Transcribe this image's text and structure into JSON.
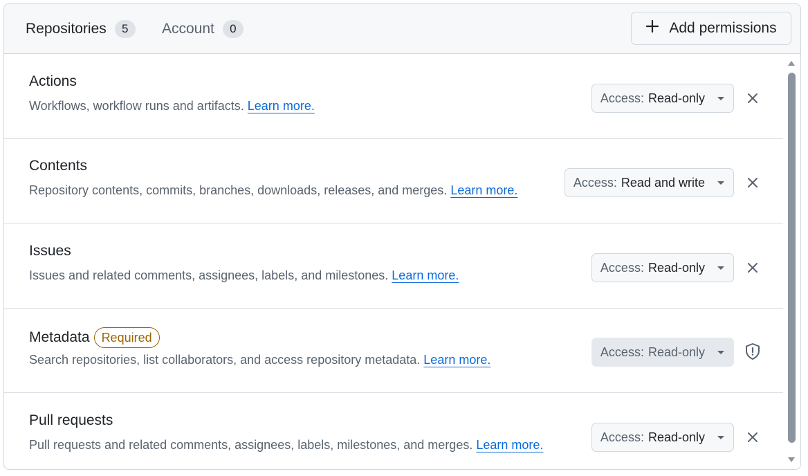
{
  "tabs": [
    {
      "label": "Repositories",
      "count": "5"
    },
    {
      "label": "Account",
      "count": "0"
    }
  ],
  "add_button": {
    "label": "Add permissions"
  },
  "permissions": [
    {
      "title": "Actions",
      "description": "Workflows, workflow runs and artifacts.",
      "link": "Learn more.",
      "access_label": "Access:",
      "access_value": "Read-only"
    },
    {
      "title": "Contents",
      "description": "Repository contents, commits, branches, downloads, releases, and merges.",
      "link": "Learn more.",
      "access_label": "Access:",
      "access_value": "Read and write"
    },
    {
      "title": "Issues",
      "description": "Issues and related comments, assignees, labels, and milestones.",
      "link": "Learn more.",
      "access_label": "Access:",
      "access_value": "Read-only"
    },
    {
      "title": "Metadata",
      "badge": "Required",
      "description": "Search repositories, list collaborators, and access repository metadata.",
      "link": "Learn more.",
      "access_label": "Access:",
      "access_value": "Read-only"
    },
    {
      "title": "Pull requests",
      "description": "Pull requests and related comments, assignees, labels, milestones, and merges.",
      "link": "Learn more.",
      "access_label": "Access:",
      "access_value": "Read-only"
    }
  ],
  "icons": {
    "add": "plus-icon",
    "remove": "close-icon",
    "required": "shield-icon",
    "dropdown": "caret-down-icon"
  },
  "colors": {
    "link": "#0969da",
    "required_badge": "#9a6700",
    "header_bg": "#f6f8fa",
    "border": "#d0d7de"
  }
}
